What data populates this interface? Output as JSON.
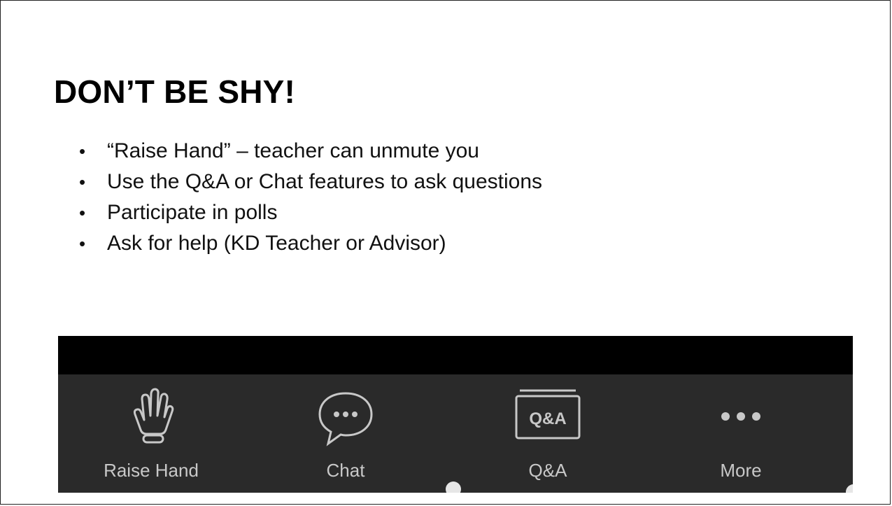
{
  "slide": {
    "title": "DON’T BE SHY!",
    "bullets": [
      "“Raise Hand” – teacher can unmute you",
      "Use the Q&A or Chat features to ask questions",
      "Participate in polls",
      "Ask for help (KD Teacher or Advisor)"
    ],
    "bullet_char": "•"
  },
  "toolbar": {
    "items": [
      {
        "label": "Raise Hand",
        "icon": "raise-hand-icon"
      },
      {
        "label": "Chat",
        "icon": "chat-bubble-icon"
      },
      {
        "label": "Q&A",
        "icon": "qa-icon",
        "icon_text": "Q&A"
      },
      {
        "label": "More",
        "icon": "more-dots-icon"
      }
    ],
    "colors": {
      "bar": "#2a2a2a",
      "top": "#000000",
      "icon": "#c8c8c8"
    }
  }
}
